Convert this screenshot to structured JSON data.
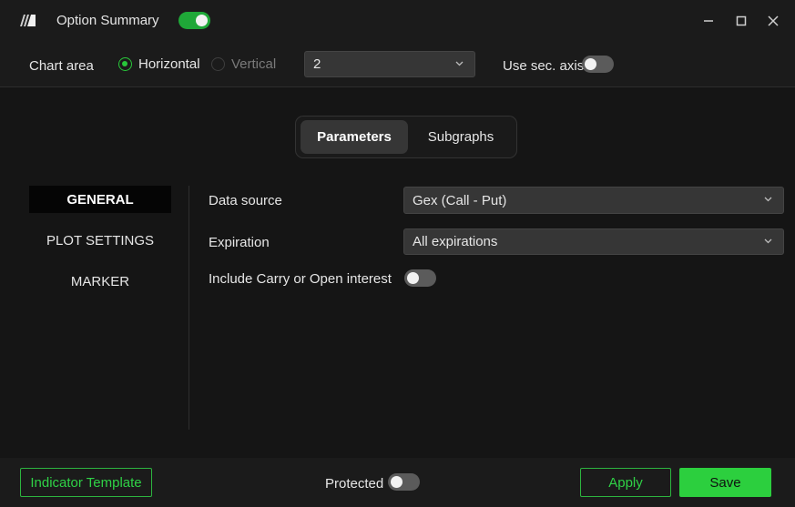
{
  "window": {
    "title": "Option Summary",
    "title_toggle_on": true
  },
  "toolbar": {
    "chart_area_label": "Chart area",
    "orientation_options": [
      "Horizontal",
      "Vertical"
    ],
    "orientation_selected": "Horizontal",
    "count_value": "2",
    "sec_axis_label": "Use sec. axis",
    "sec_axis_on": false
  },
  "tabs": {
    "items": [
      "Parameters",
      "Subgraphs"
    ],
    "active": "Parameters"
  },
  "sidebar": {
    "items": [
      "GENERAL",
      "PLOT SETTINGS",
      "MARKER"
    ],
    "active": "GENERAL"
  },
  "general": {
    "data_source_label": "Data source",
    "data_source_value": "Gex (Call - Put)",
    "expiration_label": "Expiration",
    "expiration_value": "All expirations",
    "carry_label": "Include Carry or Open interest",
    "carry_on": false
  },
  "footer": {
    "template_label": "Indicator Template",
    "protected_label": "Protected",
    "protected_on": false,
    "apply_label": "Apply",
    "save_label": "Save"
  },
  "colors": {
    "accent": "#2ccf3e",
    "background": "#151515",
    "panel": "#1b1b1b"
  }
}
